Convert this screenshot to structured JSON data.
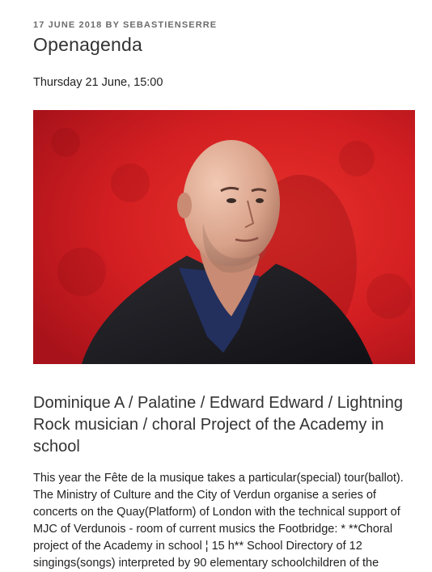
{
  "post": {
    "date": "17 JUNE 2018",
    "by": "BY",
    "author": "SEBASTIENSERRE",
    "title": "Openagenda",
    "event_date": "Thursday 21 June, 15:00",
    "image_alt": "Portrait of a bald man against a red wall",
    "heading": "Dominique A / Palatine / Edward Edward / Lightning Rock musician / choral Project of the Academy in school",
    "body": "This year the Fête de la musique takes a particular(special) tour(ballot). The Ministry of Culture and the City of Verdun organise a series of concerts on the Quay(Platform) of London with the technical support of MJC of Verdunois - room of current musics the Footbridge: * **Choral project of the Academy in school ¦ 15 h** School Directory of 12 singings(songs) interpreted by 90 elementary schoolchildren of the"
  },
  "colors": {
    "meta": "#6c6c6c",
    "title": "#333333",
    "text": "#222222",
    "wall_red": "#d41f22"
  }
}
